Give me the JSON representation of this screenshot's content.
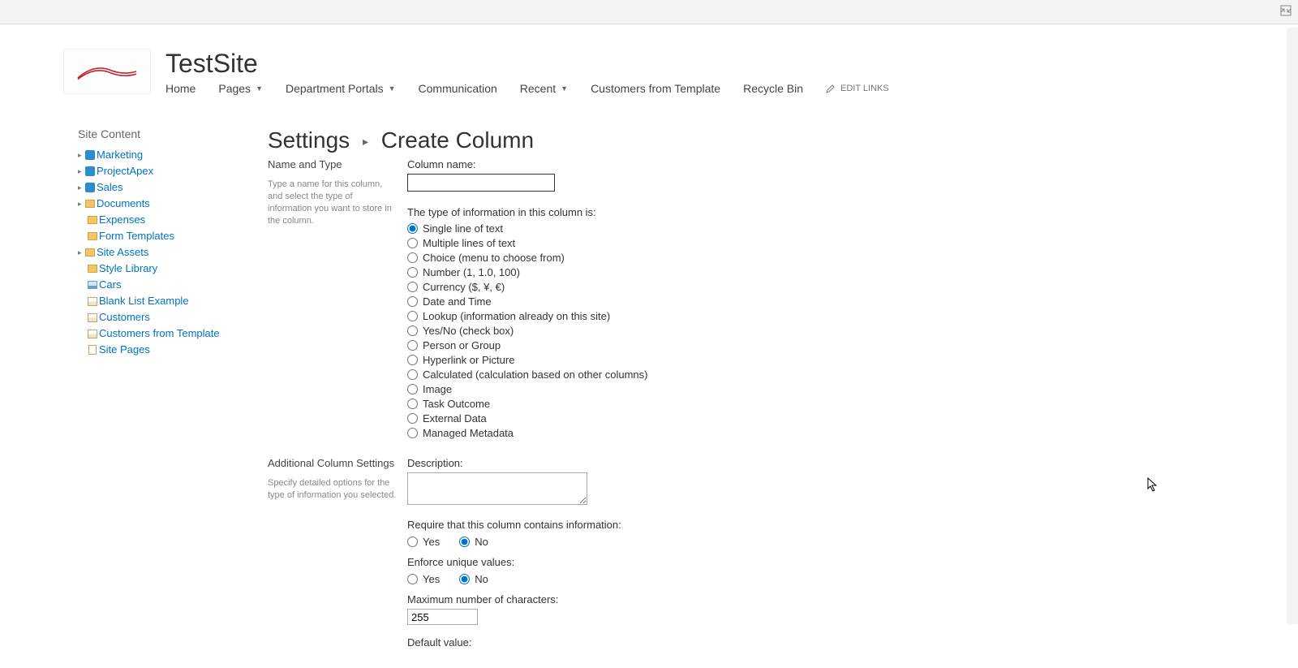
{
  "site": {
    "title": "TestSite"
  },
  "topnav": {
    "home": "Home",
    "pages": "Pages",
    "dept": "Department Portals",
    "comm": "Communication",
    "recent": "Recent",
    "cust": "Customers from Template",
    "recycle": "Recycle Bin",
    "edit": "EDIT LINKS"
  },
  "leftnav": {
    "title": "Site Content",
    "items": [
      "Marketing",
      "ProjectApex",
      "Sales",
      "Documents",
      "Expenses",
      "Form Templates",
      "Site Assets",
      "Style Library",
      "Cars",
      "Blank List Example",
      "Customers",
      "Customers from Template",
      "Site Pages"
    ]
  },
  "breadcrumb": {
    "settings": "Settings",
    "current": "Create Column"
  },
  "section1": {
    "title": "Name and Type",
    "help": "Type a name for this column, and select the type of information you want to store in the column."
  },
  "labels": {
    "colname": "Column name:",
    "typeprompt": "The type of information in this column is:"
  },
  "types": [
    "Single line of text",
    "Multiple lines of text",
    "Choice (menu to choose from)",
    "Number (1, 1.0, 100)",
    "Currency ($, ¥, €)",
    "Date and Time",
    "Lookup (information already on this site)",
    "Yes/No (check box)",
    "Person or Group",
    "Hyperlink or Picture",
    "Calculated (calculation based on other columns)",
    "Image",
    "Task Outcome",
    "External Data",
    "Managed Metadata"
  ],
  "section2": {
    "title": "Additional Column Settings",
    "help": "Specify detailed options for the type of information you selected."
  },
  "addl": {
    "desc": "Description:",
    "require": "Require that this column contains information:",
    "unique": "Enforce unique values:",
    "maxchars": "Maximum number of characters:",
    "maxchars_value": "255",
    "defaultval": "Default value:",
    "yes": "Yes",
    "no": "No"
  }
}
